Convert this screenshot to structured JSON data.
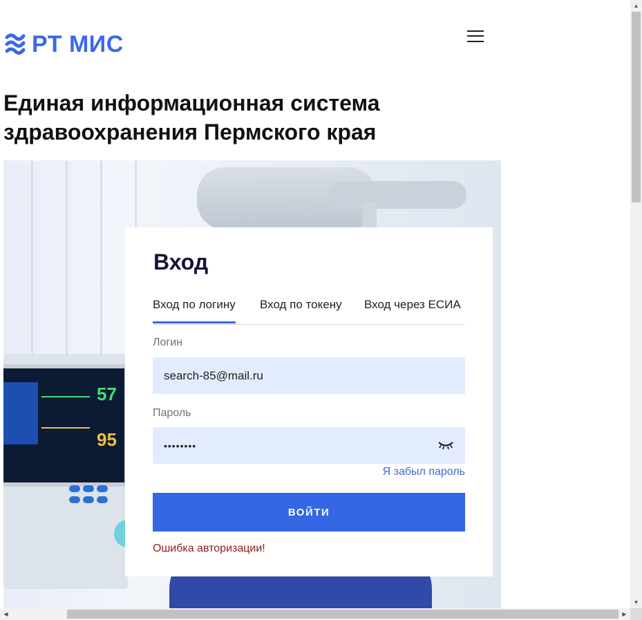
{
  "header": {
    "logo_text": "РТ МИС",
    "logo_icon": "rtmis-logo-icon",
    "menu_icon": "hamburger-menu-icon"
  },
  "headline": {
    "line1": "Единая информационная система",
    "line2": "здравоохранения Пермского края"
  },
  "hero": {
    "monitor_values": [
      "57",
      "95"
    ]
  },
  "login": {
    "title": "Вход",
    "tabs": [
      {
        "label": "Вход по логину",
        "active": true
      },
      {
        "label": "Вход по токену",
        "active": false
      },
      {
        "label": "Вход через ЕСИА",
        "active": false
      }
    ],
    "login_label": "Логин",
    "login_value": "search-85@mail.ru",
    "password_label": "Пароль",
    "password_value": "••••••••",
    "password_toggle_icon": "eye-closed-icon",
    "forgot_link": "Я забыл пароль",
    "submit_label": "ВОЙТИ",
    "error_text": "Ошибка авторизации!"
  },
  "colors": {
    "accent": "#3567e5",
    "input_bg": "#e2ecfc",
    "error": "#8a1b1b",
    "title": "#15133a"
  }
}
